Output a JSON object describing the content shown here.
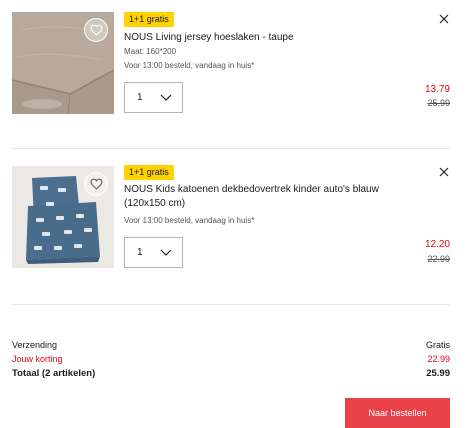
{
  "cart": {
    "items": [
      {
        "promo": "1+1 gratis",
        "title": "NOUS Living jersey hoeslaken - taupe",
        "size": "Maat: 160*200",
        "delivery": "Voor 13:00 besteld, vandaag in huis*",
        "quantity": "1",
        "price": "13.79",
        "old_price": "25.99"
      },
      {
        "promo": "1+1 gratis",
        "title": "NOUS Kids katoenen dekbedovertrek kinder auto's blauw (120x150 cm)",
        "delivery": "Voor 13:00 besteld, vandaag in huis*",
        "quantity": "1",
        "price": "12.20",
        "old_price": "22.99"
      }
    ]
  },
  "summary": {
    "shipping_label": "Verzending",
    "shipping_value": "Gratis",
    "discount_label": "Jouw korting",
    "discount_value": "22.99",
    "total_label": "Totaal (2 artikelen)",
    "total_value": "25.99"
  },
  "checkout_label": "Naar bestellen",
  "colors": {
    "accent_red": "#e30613",
    "button_red": "#e8414a",
    "promo_yellow": "#ffd200"
  },
  "icons": [
    "heart-icon",
    "close-icon",
    "chevron-down-icon"
  ]
}
